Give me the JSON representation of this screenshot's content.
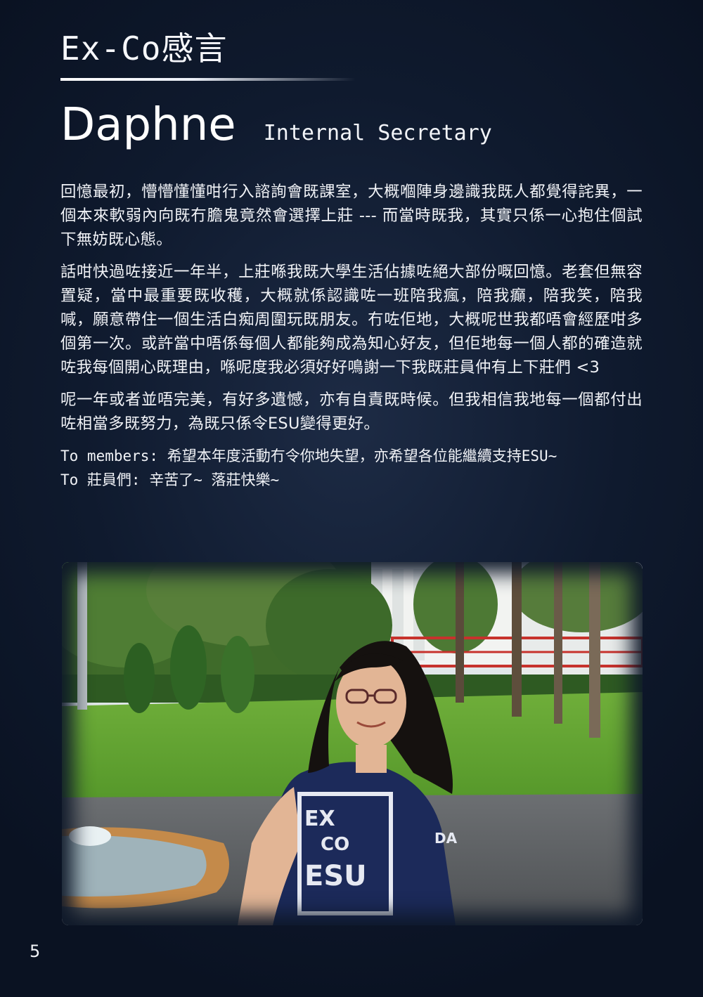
{
  "section": {
    "title": "Ex-Co感言"
  },
  "person": {
    "name": "Daphne",
    "role": "Internal Secretary"
  },
  "paragraphs": [
    "回憶最初，懵懵懂懂咁行入諮詢會既課室，大概嗰陣身邊識我既人都覺得詫異，一個本來軟弱內向既冇膽鬼竟然會選擇上莊 --- 而當時既我，其實只係一心抱住個試下無妨既心態。",
    "話咁快過咗接近一年半，上莊喺我既大學生活佔據咗絕大部份嘅回憶。老套但無容置疑，當中最重要既收穫，大概就係認識咗一班陪我瘋，陪我癲，陪我笑，陪我喊，願意帶住一個生活白痴周圍玩既朋友。冇咗佢地，大概呢世我都唔會經歷咁多個第一次。或許當中唔係每個人都能夠成為知心好友，但佢地每一個人都的確造就咗我每個開心既理由，喺呢度我必須好好鳴謝一下我既莊員仲有上下莊們 <3",
    "呢一年或者並唔完美，有好多遺憾，亦有自責既時候。但我相信我地每一個都付出咗相當多既努力，為既只係令ESU變得更好。"
  ],
  "closing": {
    "line1": "To members: 希望本年度活動冇令你地失望，亦希望各位能繼續支持ESU~",
    "line2": "To 莊員們: 辛苦了~ 落莊快樂~"
  },
  "photo": {
    "shirt_text_top": "EX",
    "shirt_text_mid": "CO",
    "shirt_text_bottom": "ESU",
    "sleeve_text": "DA"
  },
  "page_number": "5"
}
